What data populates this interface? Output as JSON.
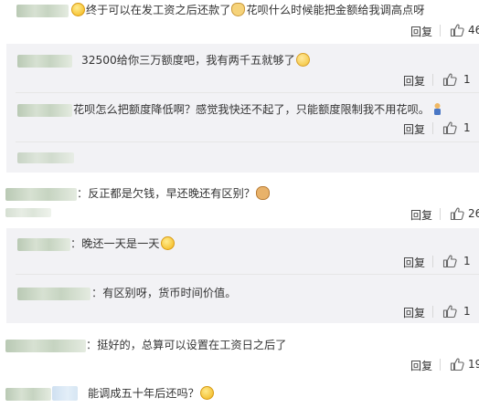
{
  "comments": [
    {
      "sep": "",
      "text": "终于可以在发工资之后还款了",
      "emoji1": "grin-sweat",
      "text2": "花呗什么时候能把金额给我调高点呀",
      "reply": "回复",
      "likes": "46"
    },
    {
      "sep": "：",
      "text": "反正都是欠钱，早还晚还有区别？",
      "emoji1": "doge",
      "reply": "回复",
      "likes": "26"
    },
    {
      "sep": "：",
      "text": "挺好的，总算可以设置在工资日之后了",
      "reply": "回复",
      "likes": "19"
    },
    {
      "sep": "",
      "text": "能调成五十年后还吗？",
      "emoji1": "thinking"
    }
  ],
  "replies_1": [
    {
      "text": "32500给你三万额度吧，我有两千五就够了",
      "emoji1": "blush",
      "reply": "回复",
      "likes": "1"
    },
    {
      "text": "花呗怎么把额度降低啊？感觉我快还不起了，只能额度限制我不用花呗。",
      "emoji1": "person",
      "reply": "回复",
      "likes": "1"
    }
  ],
  "replies_2": [
    {
      "sep": "：",
      "text": "晚还一天是一天",
      "emoji1": "grin",
      "reply": "回复",
      "likes": "1"
    },
    {
      "sep": "：",
      "text": "有区别呀，货币时间价值。",
      "reply": "回复",
      "likes": "1"
    }
  ],
  "icons": {
    "like": "thumbs-up-icon"
  },
  "colors": {
    "reply_bg": "#f2f2f5",
    "text": "#333333"
  }
}
